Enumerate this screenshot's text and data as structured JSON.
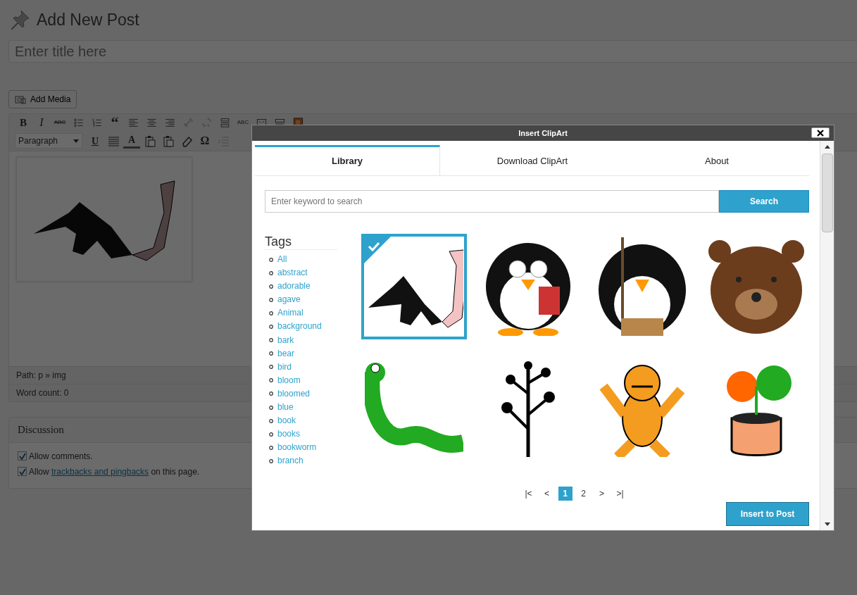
{
  "page": {
    "title": "Add New Post",
    "title_field": {
      "placeholder": "Enter title here"
    },
    "add_media": "Add Media"
  },
  "editor": {
    "toolbar_row1": [
      {
        "kind": "bold",
        "label": "B",
        "disabled": false
      },
      {
        "kind": "italic",
        "label": "I",
        "disabled": false
      },
      {
        "kind": "strike",
        "label": "ABC",
        "disabled": false
      },
      {
        "kind": "bullets",
        "disabled": false
      },
      {
        "kind": "numbers",
        "disabled": false
      },
      {
        "kind": "quote",
        "label": "“",
        "disabled": false
      },
      {
        "kind": "align-left",
        "disabled": false
      },
      {
        "kind": "align-center",
        "disabled": false
      },
      {
        "kind": "align-right",
        "disabled": false
      },
      {
        "kind": "link",
        "disabled": true
      },
      {
        "kind": "unlink",
        "disabled": true
      },
      {
        "kind": "rule",
        "disabled": false
      },
      {
        "kind": "spell",
        "label": "ABC",
        "disabled": false
      },
      {
        "kind": "fullscreen",
        "disabled": false
      },
      {
        "kind": "kitchen",
        "disabled": false
      },
      {
        "kind": "picture",
        "disabled": false
      }
    ],
    "format_select": "Paragraph",
    "toolbar_row2": [
      {
        "kind": "underline",
        "label": "U",
        "disabled": false
      },
      {
        "kind": "justify",
        "disabled": false
      },
      {
        "kind": "color",
        "label": "A",
        "disabled": false
      },
      {
        "kind": "paste",
        "disabled": false
      },
      {
        "kind": "paste",
        "disabled": false
      },
      {
        "kind": "eraser",
        "disabled": false
      },
      {
        "kind": "char",
        "label": "Ω",
        "disabled": false
      },
      {
        "kind": "outdent",
        "disabled": true
      }
    ],
    "path": "Path: p » img",
    "word_count": "Word count: 0"
  },
  "discussion": {
    "title": "Discussion",
    "options": [
      {
        "before": "Allow comments.",
        "checked": true
      },
      {
        "before": "Allow ",
        "link": "trackbacks and pingbacks",
        "after": " on this page.",
        "checked": true
      }
    ]
  },
  "dialog": {
    "title": "Insert ClipArt",
    "tabs": [
      {
        "label": "Library",
        "selected": true
      },
      {
        "label": "Download ClipArt",
        "selected": false
      },
      {
        "label": "About",
        "selected": false
      }
    ],
    "search": {
      "placeholder": "Enter keyword to search",
      "button": "Search"
    },
    "tags_title": "Tags",
    "tags": [
      "All",
      "abstract",
      "adorable",
      "agave",
      "Animal",
      "background",
      "bark",
      "bear",
      "bird",
      "bloom",
      "bloomed",
      "blue",
      "book",
      "books",
      "bookworm",
      "branch"
    ],
    "clips": [
      {
        "selected": true
      },
      {
        "selected": false
      },
      {
        "selected": false
      },
      {
        "selected": false
      },
      {
        "selected": false
      },
      {
        "selected": false
      },
      {
        "selected": false
      },
      {
        "selected": false
      }
    ],
    "pages": [
      {
        "label": "|<",
        "selected": false
      },
      {
        "label": "<",
        "selected": false
      },
      {
        "label": "1",
        "selected": true
      },
      {
        "label": "2",
        "selected": false
      },
      {
        "label": ">",
        "selected": false
      },
      {
        "label": ">|",
        "selected": false
      }
    ],
    "insert_button": "Insert to Post"
  }
}
